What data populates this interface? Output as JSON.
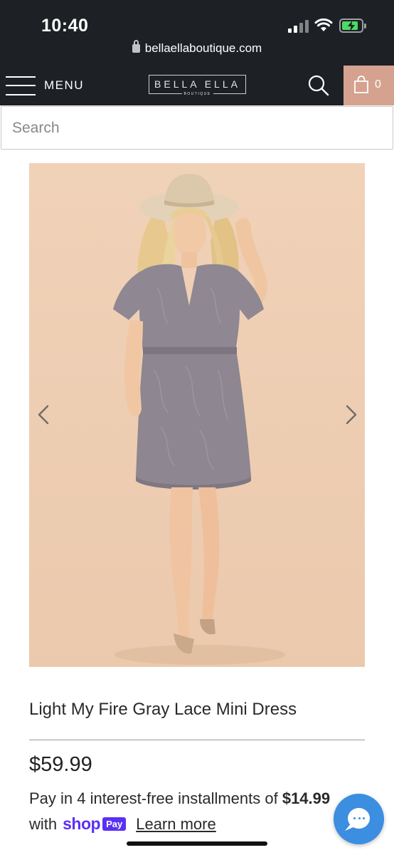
{
  "status_bar": {
    "time": "10:40",
    "url": "bellaellaboutique.com",
    "icons": [
      "signal-icon",
      "wifi-icon",
      "battery-charging-icon",
      "lock-icon"
    ]
  },
  "nav": {
    "menu_label": "MENU",
    "logo_text": "BELLA ELLA",
    "logo_subtext": "BOUTIQUE",
    "cart_count": "0",
    "icons": [
      "hamburger-icon",
      "search-icon",
      "shopping-bag-icon"
    ],
    "cart_color": "#d4a28f",
    "bar_color": "#1d2025"
  },
  "search": {
    "placeholder": "Search",
    "value": ""
  },
  "product": {
    "title": "Light My Fire Gray Lace Mini Dress",
    "price": "$59.99",
    "installments_prefix": "Pay in 4 interest-free installments of ",
    "installment_amount": "$14.99",
    "with_label": "with",
    "shop_label": "shop",
    "pay_label": "Pay",
    "learn_more": "Learn more",
    "image_background": "#efcfb4",
    "dress_color": "#8e8690"
  },
  "chat": {
    "icon": "chat-bubble-icon",
    "color": "#3b8ee0"
  }
}
